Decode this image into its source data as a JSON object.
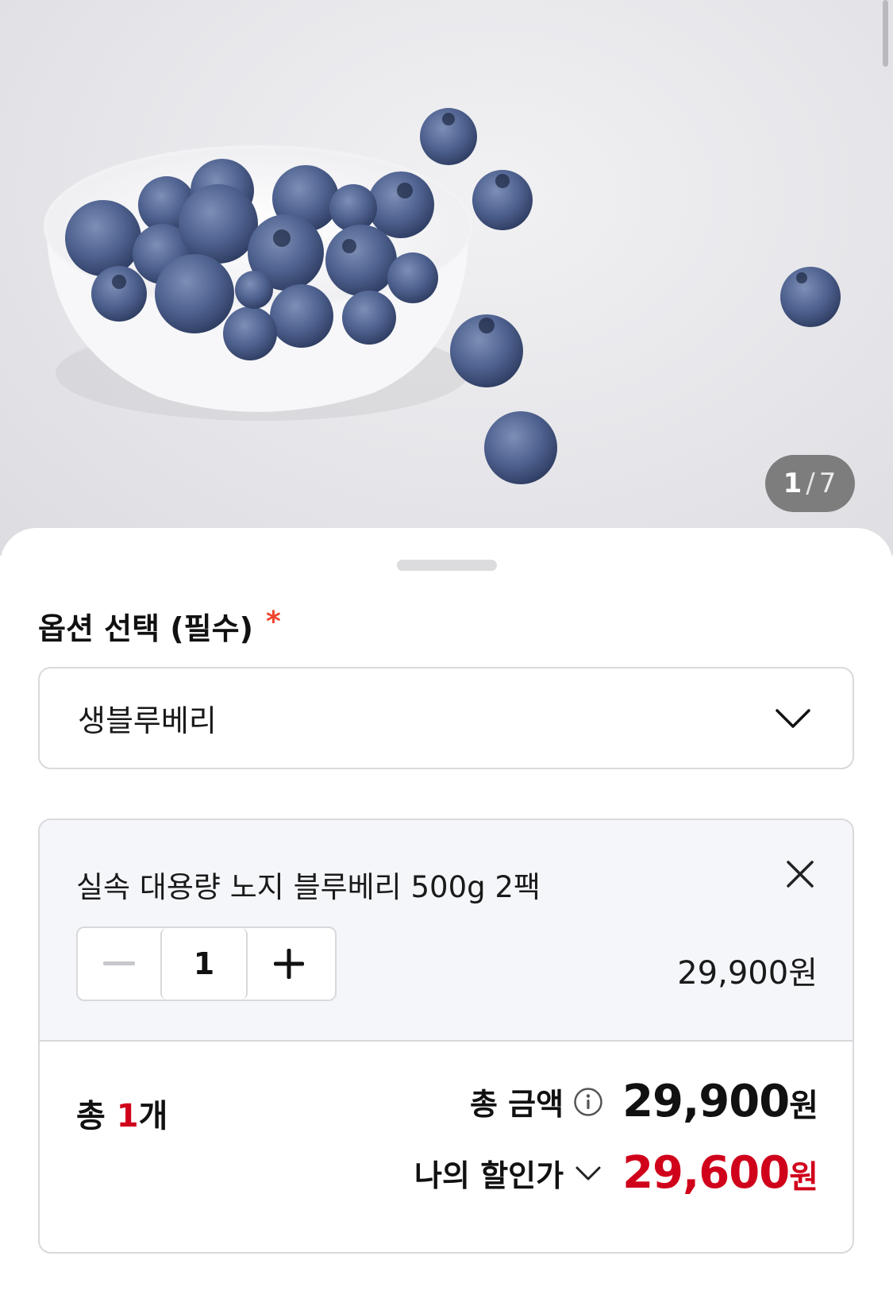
{
  "gallery": {
    "current": "1",
    "separator": "/",
    "total": "7"
  },
  "option": {
    "title": "옵션 선택 (필수)",
    "required_mark": "*",
    "selected_value": "생블루베리"
  },
  "item": {
    "name": "실속 대용량 노지 블루베리 500g 2팩",
    "quantity": "1",
    "price": "29,900원"
  },
  "summary": {
    "count_prefix": "총 ",
    "count": "1",
    "count_suffix": "개",
    "total_label": "총 금액",
    "total_amount": "29,900",
    "total_unit": "원",
    "discount_label": "나의 할인가",
    "discount_amount": "29,600",
    "discount_unit": "원"
  },
  "colors": {
    "accent_red": "#d0021b",
    "required_red": "#f0442b",
    "border": "#d9d9dd"
  }
}
